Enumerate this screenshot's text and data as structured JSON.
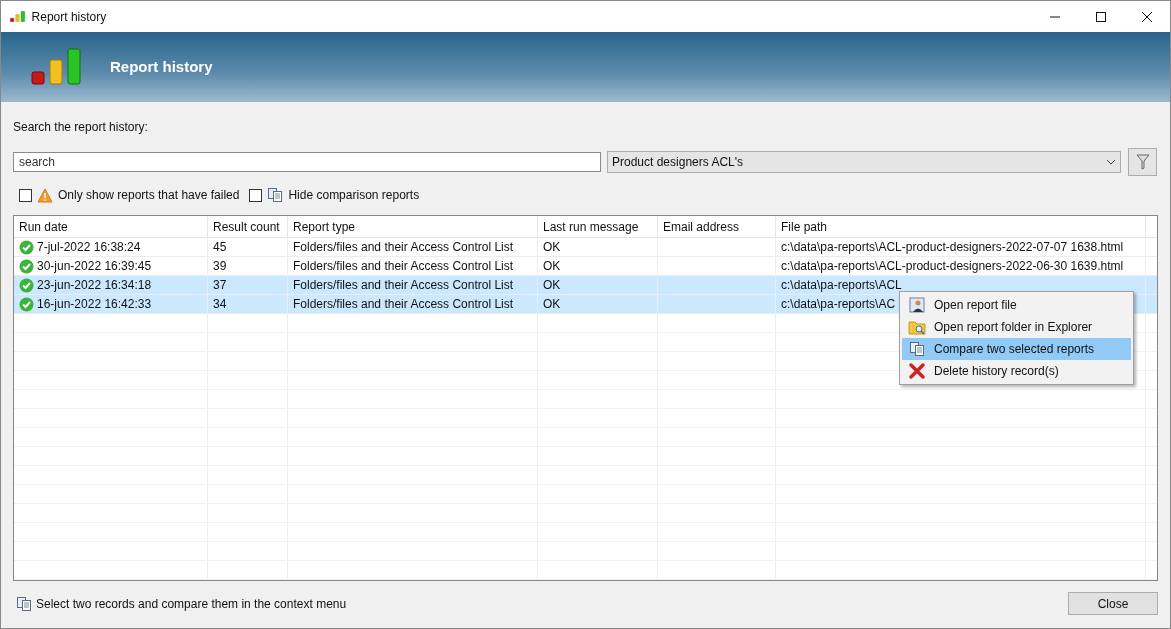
{
  "window": {
    "title": "Report history"
  },
  "header": {
    "title": "Report history"
  },
  "search": {
    "label": "Search the report history:",
    "placeholder": "search",
    "filter": "Product designers ACL's"
  },
  "options": [
    {
      "kind": "warning",
      "label": "Only show reports that have failed",
      "checked": false
    },
    {
      "kind": "compare",
      "label": "Hide comparison reports",
      "checked": false
    }
  ],
  "table": {
    "columns": [
      "Run date",
      "Result count",
      "Report type",
      "Last run message",
      "Email address",
      "File path"
    ],
    "rows": [
      {
        "selected": false,
        "cells": [
          "7-jul-2022 16:38:24",
          "45",
          "Folders/files and their Access Control List",
          "OK",
          "",
          "c:\\data\\pa-reports\\ACL-product-designers-2022-07-07 1638.html"
        ]
      },
      {
        "selected": false,
        "cells": [
          "30-jun-2022 16:39:45",
          "39",
          "Folders/files and their Access Control List",
          "OK",
          "",
          "c:\\data\\pa-reports\\ACL-product-designers-2022-06-30 1639.html"
        ]
      },
      {
        "selected": true,
        "cells": [
          "23-jun-2022 16:34:18",
          "37",
          "Folders/files and their Access Control List",
          "OK",
          "",
          "c:\\data\\pa-reports\\ACL"
        ]
      },
      {
        "selected": true,
        "cells": [
          "16-jun-2022 16:42:33",
          "34",
          "Folders/files and their Access Control List",
          "OK",
          "",
          "c:\\data\\pa-reports\\AC"
        ]
      }
    ]
  },
  "context_menu": [
    {
      "kind": "file",
      "label": "Open report file",
      "selected": false
    },
    {
      "kind": "folder",
      "label": "Open report folder in Explorer",
      "selected": false
    },
    {
      "kind": "compare",
      "label": "Compare two selected reports",
      "selected": true
    },
    {
      "kind": "delete",
      "label": "Delete history record(s)",
      "selected": false
    }
  ],
  "footer": {
    "hint": "Select two records and compare them in the context menu",
    "close": "Close"
  }
}
